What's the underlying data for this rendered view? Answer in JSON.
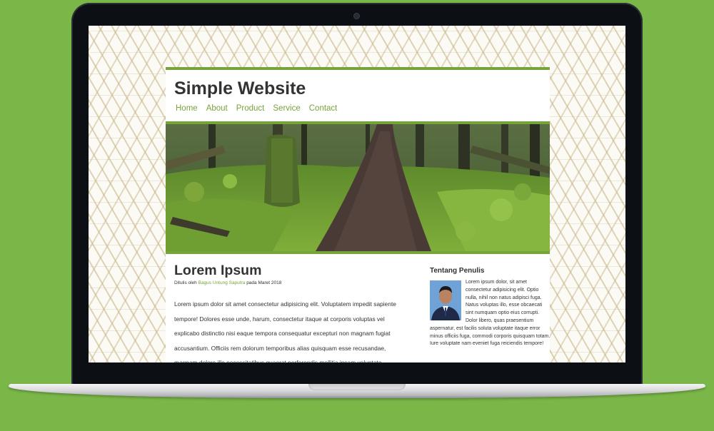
{
  "site": {
    "title": "Simple Website",
    "nav": [
      "Home",
      "About",
      "Product",
      "Service",
      "Contact"
    ],
    "accent_color": "#77a33b"
  },
  "hero": {
    "image": "forest-path-photo"
  },
  "article": {
    "title": "Lorem Ipsum",
    "byline_prefix": "Ditulis oleh ",
    "author": "Bagus Untung Saputra",
    "byline_suffix": " pada Maret 2018",
    "body": "Lorem ipsum dolor sit amet consectetur adipisicing elit. Voluptatem impedit sapiente tempore! Dolores esse unde, harum, consectetur itaque at corporis voluptas vel explicabo distinctio nisi eaque tempora consequatur excepturi non magnam fugiat accusantium. Officiis rem dolorum temporibus alias quisquam esse recusandae, magnam dolore illo necessitatibus quaerat perferendis mollitia ipsam voluptate."
  },
  "sidebar": {
    "heading": "Tentang Penulis",
    "bio": "Lorem ipsum dolor, sit amet consectetur adipisicing elit. Optio nulla, nihil non natus adipisci fuga. Natus voluptas illo, esse obcaecati sint numquam optio eius corrupti. Dolor libero, quas praesentium aspernatur, est facilis soluta voluptate itaque error minus officiis fuga, commodi corporis quisquam totam. Iure voluptate nam eveniet fuga reiciendis tempore!"
  }
}
